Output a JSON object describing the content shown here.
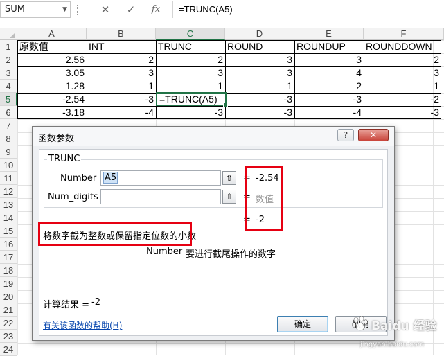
{
  "formula_bar": {
    "name_box": "SUM",
    "cancel_glyph": "✕",
    "enter_glyph": "✓",
    "fx_glyph": "fx",
    "formula": "=TRUNC(A5)"
  },
  "columns": [
    "A",
    "B",
    "C",
    "D",
    "E",
    "F"
  ],
  "rows": [
    "1",
    "2",
    "3",
    "4",
    "5",
    "6",
    "7",
    "8",
    "9",
    "10",
    "11",
    "12",
    "13",
    "14",
    "15",
    "16",
    "17",
    "18",
    "19",
    "20",
    "21",
    "22",
    "23",
    "24"
  ],
  "headers": [
    "原数值",
    "INT",
    "TRUNC",
    "ROUND",
    "ROUNDUP",
    "ROUNDDOWN"
  ],
  "data_rows": [
    [
      "2.56",
      "2",
      "2",
      "3",
      "3",
      "2"
    ],
    [
      "3.05",
      "3",
      "3",
      "3",
      "4",
      "3"
    ],
    [
      "1.28",
      "1",
      "1",
      "1",
      "2",
      "1"
    ],
    [
      "-2.54",
      "-3",
      "=TRUNC(A5)",
      "-3",
      "-3",
      "-2"
    ],
    [
      "-3.18",
      "-4",
      "-3",
      "-3",
      "-4",
      "-3"
    ]
  ],
  "dialog": {
    "title": "函数参数",
    "help_btn": "?",
    "close_btn": "✕",
    "function_name": "TRUNC",
    "arg1_label": "Number",
    "arg1_value": "A5",
    "arg1_result": "-2.54",
    "arg2_label": "Num_digits",
    "arg2_value": "",
    "arg2_result": "数值",
    "eq": "=",
    "overall_result": "-2",
    "description": "将数字截为整数或保留指定位数的小数",
    "arg_help_name": "Number",
    "arg_help_text": "要进行截尾操作的数字",
    "calc_result_label": "计算结果 =",
    "calc_result_value": "-2",
    "help_link": "有关该函数的帮助(H)",
    "ok_btn": "确定",
    "cancel_btn": "取消"
  },
  "watermark": {
    "text": "Baidu 经验",
    "url": "jingyan.baidu.com"
  },
  "colors": {
    "accent_green": "#217346",
    "highlight_red": "#e60012",
    "link_blue": "#0645ad"
  }
}
